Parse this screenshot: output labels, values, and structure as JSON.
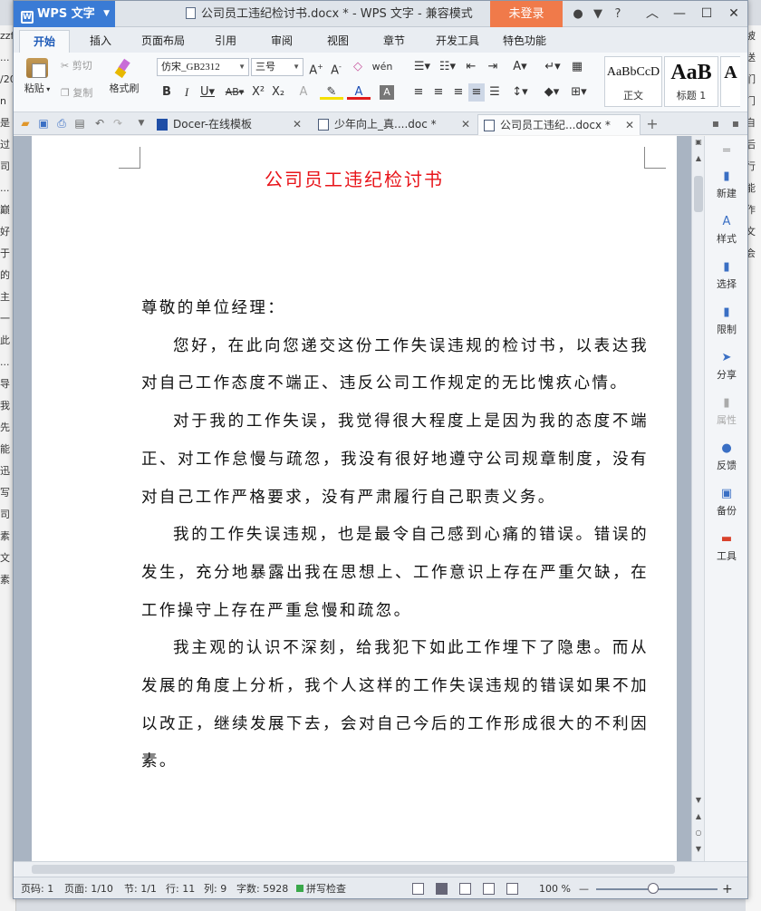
{
  "window": {
    "app_name": "WPS 文字",
    "app_logo_letter": "W",
    "title": "公司员工违纪检讨书.docx * - WPS 文字 - 兼容模式",
    "login_button": "未登录",
    "help_label": "?"
  },
  "menu": {
    "tabs": [
      "开始",
      "插入",
      "页面布局",
      "引用",
      "审阅",
      "视图",
      "章节",
      "开发工具",
      "特色功能"
    ]
  },
  "ribbon": {
    "paste": "粘贴",
    "cut": "剪切",
    "copy": "复制",
    "format_painter": "格式刷",
    "font_name": "仿宋_GB2312",
    "font_size": "三号",
    "styles": [
      {
        "preview": "AaBbCcD",
        "name": "正文"
      },
      {
        "preview": "AaB",
        "name": "标题 1"
      },
      {
        "preview": "A",
        "name": ""
      }
    ]
  },
  "doc_tabs": [
    {
      "label": "Docer-在线模板",
      "active": false
    },
    {
      "label": "少年向上_真....doc *",
      "active": false
    },
    {
      "label": "公司员工违纪...docx *",
      "active": true
    }
  ],
  "document": {
    "title": "公司员工违纪检讨书",
    "salutation": "尊敬的单位经理：",
    "paragraphs": [
      "您好，在此向您递交这份工作失误违规的检讨书，以表达我对自己工作态度不端正、违反公司工作规定的无比愧疚心情。",
      "对于我的工作失误，我觉得很大程度上是因为我的态度不端正、对工作怠慢与疏忽，我没有很好地遵守公司规章制度，没有对自己工作严格要求，没有严肃履行自己职责义务。",
      "我的工作失误违规，也是最令自己感到心痛的错误。错误的发生，充分地暴露出我在思想上、工作意识上存在严重欠缺，在工作操守上存在严重怠慢和疏忽。",
      "我主观的认识不深刻，给我犯下如此工作埋下了隐患。而从发展的角度上分析，我个人这样的工作失误违规的错误如果不加以改正，继续发展下去，会对自己今后的工作形成很大的不利因素。"
    ]
  },
  "task_pane": [
    "新建",
    "样式",
    "选择",
    "限制",
    "分享",
    "属性",
    "反馈",
    "备份",
    "工具"
  ],
  "status_bar": {
    "page_num": "页码: 1",
    "pages": "页面: 1/10",
    "section": "节: 1/1",
    "row": "行: 11",
    "col": "列: 9",
    "word_count": "字数: 5928",
    "spell_check": "拼写检查",
    "zoom": "100 %"
  },
  "background_text": {
    "left": [
      "zzf",
      "...",
      "/20",
      "n",
      "是",
      "过",
      "司",
      "...",
      "巅",
      "好",
      "于",
      "的",
      "主",
      "一",
      "此",
      "...",
      "导",
      "我",
      "先",
      "能",
      "迅",
      "写",
      "司",
      "素",
      "文",
      "素"
    ],
    "right": [
      "坡",
      "送",
      "们",
      "门",
      "自",
      "后",
      "行",
      "能",
      "作",
      "文",
      "会"
    ]
  },
  "colors": {
    "accent": "#3a7bd5",
    "login": "#f07a4a",
    "doc_title": "#e8141a"
  }
}
